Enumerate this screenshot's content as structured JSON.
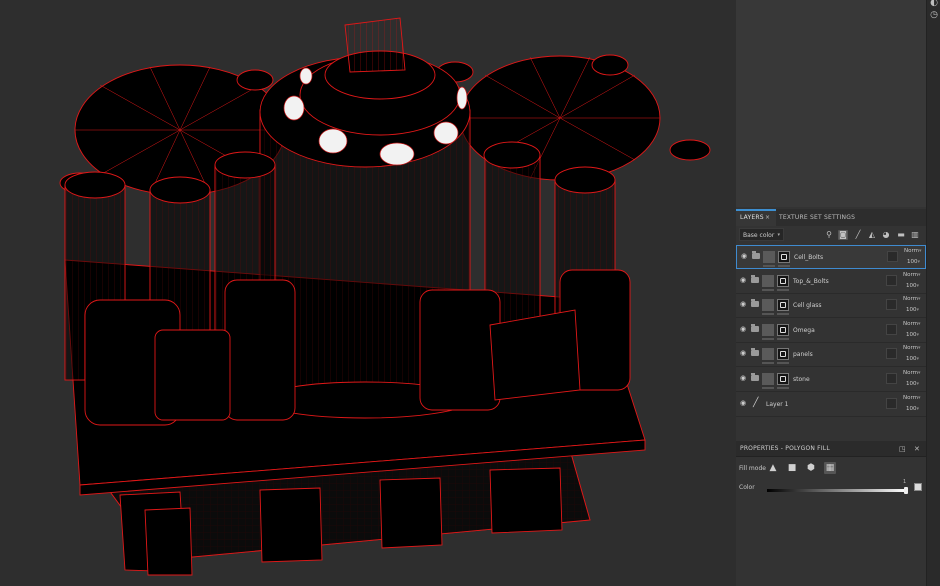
{
  "viewport": {
    "wire_color": "#d01010",
    "highlight_color": "#f0f0f0"
  },
  "icons": {
    "strip": [
      "undo-history-icon",
      "clock-icon"
    ],
    "toolbar": [
      "add-effect-icon",
      "add-mask-icon",
      "add-paint-layer-icon",
      "add-fill-layer-icon",
      "smart-material-icon",
      "add-folder-icon",
      "delete-layer-icon"
    ],
    "fill_modes": [
      "triangle-fill-icon",
      "polygon-fill-icon",
      "mesh-fill-icon",
      "uv-fill-icon"
    ]
  },
  "tabs": {
    "layers": "LAYERS",
    "layers_close": "×",
    "texture_set_settings": "TEXTURE SET SETTINGS"
  },
  "toolbar": {
    "channel": "Base color",
    "channel_chevron": "▾"
  },
  "layers": [
    {
      "name": "Cell_Bolts",
      "blend": "Norm",
      "opacity": "100",
      "type": "fill-folder",
      "selected": true
    },
    {
      "name": "Top_&_Bolts",
      "blend": "Norm",
      "opacity": "100",
      "type": "fill-folder",
      "selected": false
    },
    {
      "name": "Cell glass",
      "blend": "Norm",
      "opacity": "100",
      "type": "fill-folder",
      "selected": false
    },
    {
      "name": "Omega",
      "blend": "Norm",
      "opacity": "100",
      "type": "fill-folder",
      "selected": false
    },
    {
      "name": "panels",
      "blend": "Norm",
      "opacity": "100",
      "type": "fill-folder",
      "selected": false
    },
    {
      "name": "stone",
      "blend": "Norm",
      "opacity": "100",
      "type": "fill-folder",
      "selected": false
    },
    {
      "name": "Layer 1",
      "blend": "Norm",
      "opacity": "100",
      "type": "paint",
      "selected": false
    }
  ],
  "properties": {
    "title": "PROPERTIES - POLYGON FILL",
    "fill_mode_label": "Fill mode",
    "active_fill_mode": 3,
    "color_label": "Color",
    "color_value": "1"
  }
}
